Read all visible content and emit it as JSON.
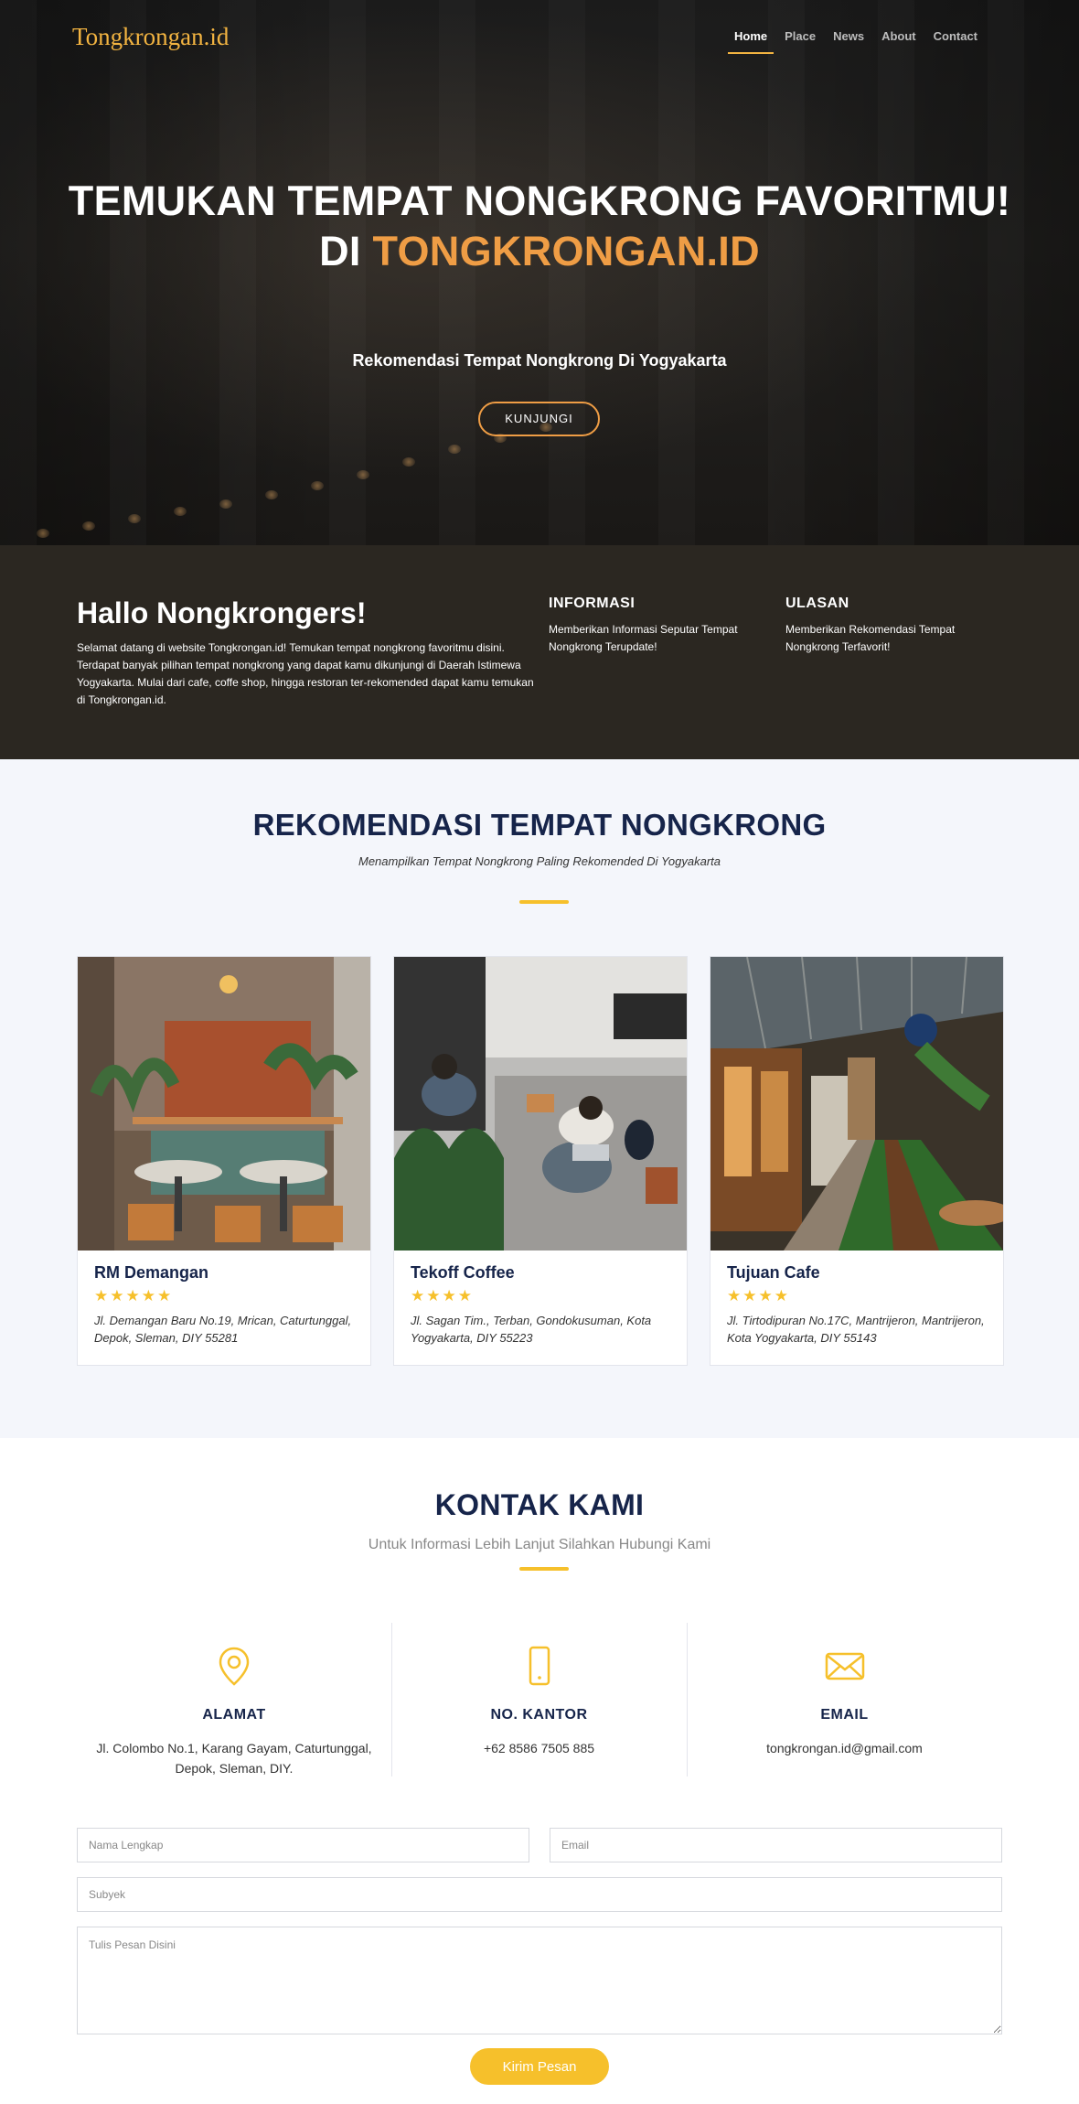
{
  "nav": {
    "logo": "Tongkrongan.id",
    "items": [
      {
        "label": "Home",
        "active": true
      },
      {
        "label": "Place",
        "active": false
      },
      {
        "label": "News",
        "active": false
      },
      {
        "label": "About",
        "active": false
      },
      {
        "label": "Contact",
        "active": false
      }
    ]
  },
  "hero": {
    "title_line1": "TEMUKAN TEMPAT NONGKRONG FAVORITMU!",
    "title_line2_prefix": "DI ",
    "title_line2_accent": "TONGKRONGAN.ID",
    "subtitle": "Rekomendasi Tempat Nongkrong Di Yogyakarta",
    "button_label": "KUNJUNGI",
    "accent_color": "#ef9d45"
  },
  "about": {
    "heading": "Hallo Nongkrongers!",
    "text": "Selamat datang di website Tongkrongan.id! Temukan tempat nongkrong favoritmu disini. Terdapat banyak pilihan tempat nongkrong yang dapat kamu dikunjungi di Daerah Istimewa Yogyakarta. Mulai dari cafe, coffe shop, hingga restoran ter-rekomended dapat kamu temukan di Tongkrongan.id.",
    "columns": [
      {
        "title": "INFORMASI",
        "text": "Memberikan Informasi Seputar Tempat Nongkrong Terupdate!"
      },
      {
        "title": "ULASAN",
        "text": "Memberikan Rekomendasi Tempat Nongkrong Terfavorit!"
      }
    ]
  },
  "recommendations": {
    "title": "REKOMENDASI TEMPAT NONGKRONG",
    "subtitle": "Menampilkan Tempat Nongkrong Paling Rekomended Di Yogyakarta",
    "cards": [
      {
        "name": "RM Demangan",
        "rating": 5,
        "stars": "★★★★★",
        "address": "Jl. Demangan Baru No.19, Mrican, Caturtunggal, Depok, Sleman, DIY 55281"
      },
      {
        "name": "Tekoff Coffee",
        "rating": 4,
        "stars": "★★★★",
        "address": "Jl. Sagan Tim., Terban, Gondokusuman, Kota Yogyakarta, DIY 55223"
      },
      {
        "name": "Tujuan Cafe",
        "rating": 4,
        "stars": "★★★★",
        "address": "Jl. Tirtodipuran No.17C, Mantrijeron, Mantrijeron, Kota Yogyakarta, DIY 55143"
      }
    ]
  },
  "contact": {
    "title": "KONTAK KAMI",
    "subtitle": "Untuk Informasi Lebih Lanjut Silahkan Hubungi Kami",
    "info": [
      {
        "icon": "map-pin-icon",
        "title": "ALAMAT",
        "text": "Jl. Colombo No.1, Karang Gayam, Caturtunggal, Depok, Sleman, DIY."
      },
      {
        "icon": "phone-icon",
        "title": "NO. KANTOR",
        "text": "+62 8586 7505 885"
      },
      {
        "icon": "mail-icon",
        "title": "EMAIL",
        "text": "tongkrongan.id@gmail.com"
      }
    ],
    "form": {
      "name_placeholder": "Nama Lengkap",
      "email_placeholder": "Email",
      "subject_placeholder": "Subyek",
      "message_placeholder": "Tulis Pesan Disini",
      "submit_label": "Kirim Pesan"
    },
    "accent_color": "#f6c02b"
  }
}
